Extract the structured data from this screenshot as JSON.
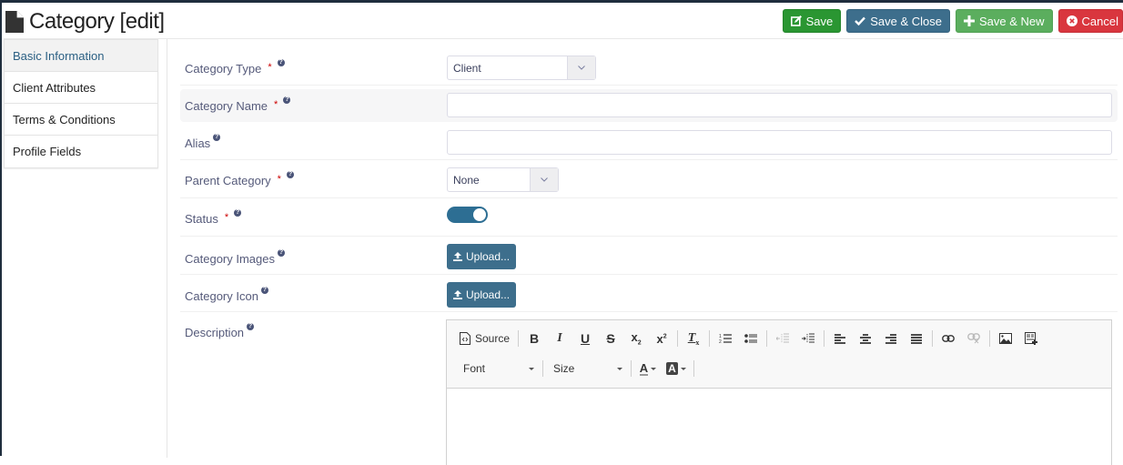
{
  "header": {
    "title": "Category [edit]",
    "buttons": {
      "save": "Save",
      "save_close": "Save & Close",
      "save_new": "Save & New",
      "cancel": "Cancel"
    }
  },
  "sidebar": {
    "items": [
      {
        "label": "Basic Information",
        "active": true
      },
      {
        "label": "Client Attributes",
        "active": false
      },
      {
        "label": "Terms & Conditions",
        "active": false
      },
      {
        "label": "Profile Fields",
        "active": false
      }
    ]
  },
  "form": {
    "category_type": {
      "label": "Category Type",
      "required": true,
      "value": "Client"
    },
    "category_name": {
      "label": "Category Name",
      "required": true,
      "value": ""
    },
    "alias": {
      "label": "Alias",
      "required": false,
      "value": ""
    },
    "parent_category": {
      "label": "Parent Category",
      "required": true,
      "value": "None"
    },
    "status": {
      "label": "Status",
      "required": true,
      "enabled": true
    },
    "category_images": {
      "label": "Category Images",
      "button": "Upload..."
    },
    "category_icon": {
      "label": "Category Icon",
      "button": "Upload..."
    },
    "description": {
      "label": "Description",
      "value": ""
    }
  },
  "editor": {
    "source_label": "Source",
    "font_label": "Font",
    "size_label": "Size",
    "bold": "B",
    "italic": "I",
    "underline": "U",
    "strike": "S"
  },
  "help_glyph": "?",
  "required_glyph": "*"
}
